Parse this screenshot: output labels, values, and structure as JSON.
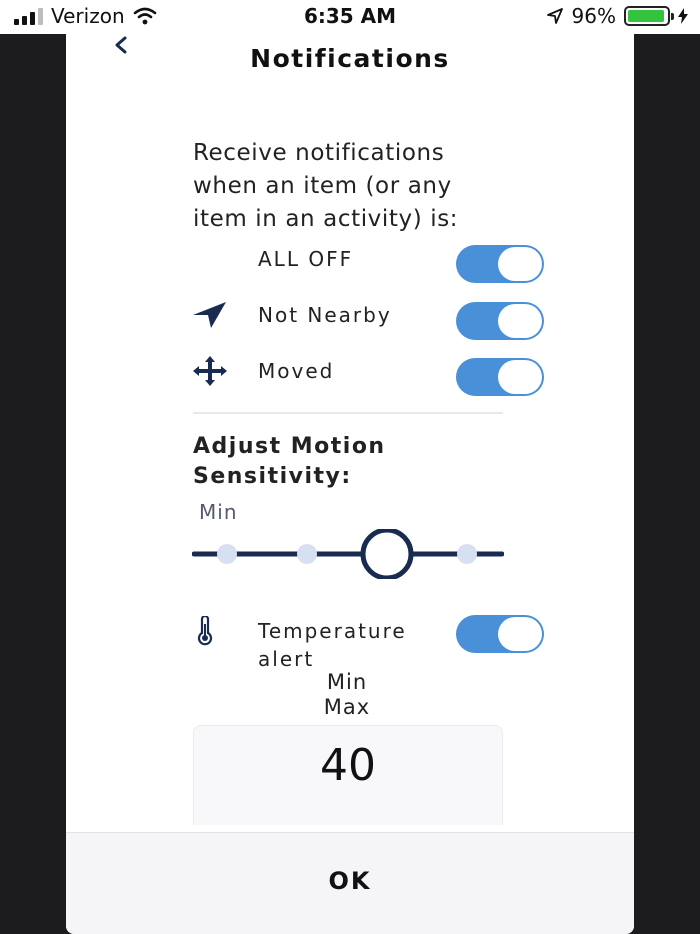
{
  "status_bar": {
    "carrier": "Verizon",
    "time": "6:35 AM",
    "battery": "96%",
    "battery_level": 0.96
  },
  "header": {
    "title": "Notifications",
    "back_icon": "chevron-left-icon"
  },
  "intro_text": "Receive notifications when an item (or any item in an activity) is:",
  "toggles": [
    {
      "label": "ALL OFF",
      "on": true
    },
    {
      "label": "Not Nearby",
      "icon": "location-arrow-icon",
      "on": true
    },
    {
      "label": "Moved",
      "icon": "move-arrows-icon",
      "on": true
    }
  ],
  "motion": {
    "title": "Adjust Motion Sensitivity:",
    "min_label": "Min",
    "steps": 4,
    "selected_step": 3
  },
  "temperature": {
    "label": "Temperature alert",
    "icon": "thermometer-icon",
    "on": true,
    "min_label": "Min",
    "max_label": "Max",
    "value": "40"
  },
  "footer": {
    "ok_label": "OK"
  },
  "colors": {
    "accent": "#4a90d9",
    "navy": "#1a2b52",
    "slider_dot": "#d6e0f2"
  }
}
